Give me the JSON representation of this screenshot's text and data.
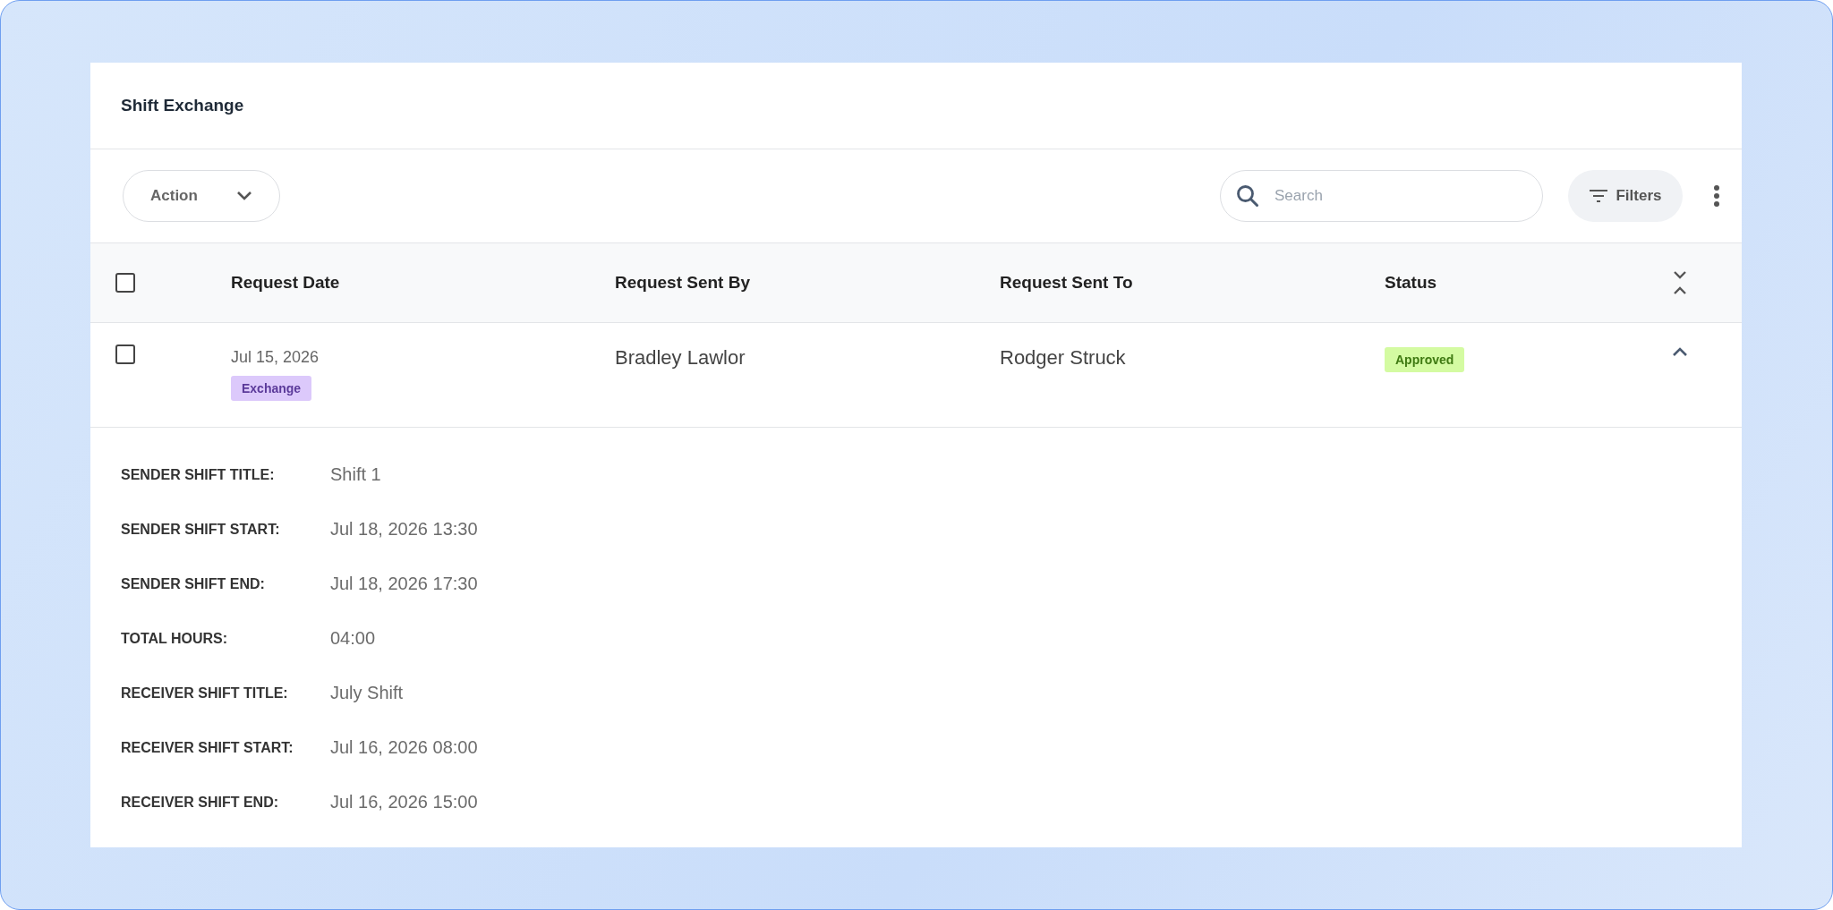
{
  "panel": {
    "title": "Shift Exchange"
  },
  "toolbar": {
    "action_button": "Action",
    "search": {
      "placeholder": "Search"
    },
    "filters_button": "Filters"
  },
  "table": {
    "header_checkbox": {
      "checked": false
    },
    "columns": [
      "Request Date",
      "Request Sent By",
      "Request Sent To",
      "Status"
    ],
    "rows": [
      {
        "checked": false,
        "expanded": true,
        "request_date": "Jul 15, 2026",
        "type_tag": "Exchange",
        "sent_by": "Bradley Lawlor",
        "sent_to": "Rodger Struck",
        "status": {
          "label": "Approved",
          "kind": "approved"
        },
        "details": [
          {
            "label": "SENDER SHIFT TITLE:",
            "value": "Shift 1"
          },
          {
            "label": "SENDER SHIFT START:",
            "value": "Jul 18, 2026 13:30"
          },
          {
            "label": "SENDER SHIFT END:",
            "value": "Jul 18, 2026 17:30"
          },
          {
            "label": "TOTAL HOURS:",
            "value": "04:00"
          },
          {
            "label": "RECEIVER SHIFT TITLE:",
            "value": "July Shift"
          },
          {
            "label": "RECEIVER SHIFT START:",
            "value": "Jul 16, 2026 08:00"
          },
          {
            "label": "RECEIVER SHIFT END:",
            "value": "Jul 16, 2026 15:00"
          }
        ]
      }
    ]
  }
}
